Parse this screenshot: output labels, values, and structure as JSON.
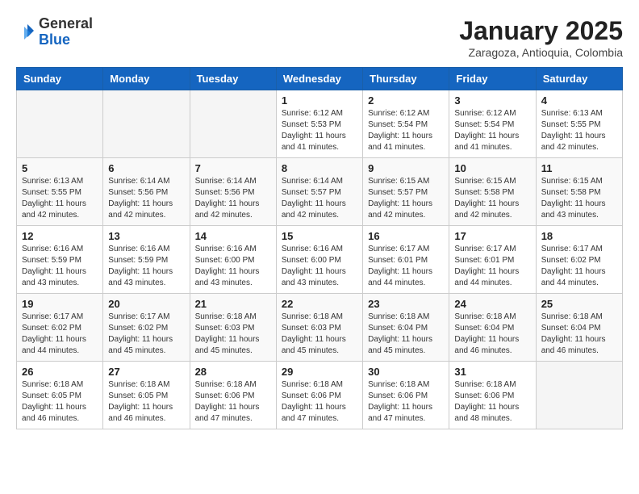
{
  "header": {
    "logo_general": "General",
    "logo_blue": "Blue",
    "month_title": "January 2025",
    "location": "Zaragoza, Antioquia, Colombia"
  },
  "weekdays": [
    "Sunday",
    "Monday",
    "Tuesday",
    "Wednesday",
    "Thursday",
    "Friday",
    "Saturday"
  ],
  "weeks": [
    [
      {
        "day": "",
        "info": ""
      },
      {
        "day": "",
        "info": ""
      },
      {
        "day": "",
        "info": ""
      },
      {
        "day": "1",
        "info": "Sunrise: 6:12 AM\nSunset: 5:53 PM\nDaylight: 11 hours and 41 minutes."
      },
      {
        "day": "2",
        "info": "Sunrise: 6:12 AM\nSunset: 5:54 PM\nDaylight: 11 hours and 41 minutes."
      },
      {
        "day": "3",
        "info": "Sunrise: 6:12 AM\nSunset: 5:54 PM\nDaylight: 11 hours and 41 minutes."
      },
      {
        "day": "4",
        "info": "Sunrise: 6:13 AM\nSunset: 5:55 PM\nDaylight: 11 hours and 42 minutes."
      }
    ],
    [
      {
        "day": "5",
        "info": "Sunrise: 6:13 AM\nSunset: 5:55 PM\nDaylight: 11 hours and 42 minutes."
      },
      {
        "day": "6",
        "info": "Sunrise: 6:14 AM\nSunset: 5:56 PM\nDaylight: 11 hours and 42 minutes."
      },
      {
        "day": "7",
        "info": "Sunrise: 6:14 AM\nSunset: 5:56 PM\nDaylight: 11 hours and 42 minutes."
      },
      {
        "day": "8",
        "info": "Sunrise: 6:14 AM\nSunset: 5:57 PM\nDaylight: 11 hours and 42 minutes."
      },
      {
        "day": "9",
        "info": "Sunrise: 6:15 AM\nSunset: 5:57 PM\nDaylight: 11 hours and 42 minutes."
      },
      {
        "day": "10",
        "info": "Sunrise: 6:15 AM\nSunset: 5:58 PM\nDaylight: 11 hours and 42 minutes."
      },
      {
        "day": "11",
        "info": "Sunrise: 6:15 AM\nSunset: 5:58 PM\nDaylight: 11 hours and 43 minutes."
      }
    ],
    [
      {
        "day": "12",
        "info": "Sunrise: 6:16 AM\nSunset: 5:59 PM\nDaylight: 11 hours and 43 minutes."
      },
      {
        "day": "13",
        "info": "Sunrise: 6:16 AM\nSunset: 5:59 PM\nDaylight: 11 hours and 43 minutes."
      },
      {
        "day": "14",
        "info": "Sunrise: 6:16 AM\nSunset: 6:00 PM\nDaylight: 11 hours and 43 minutes."
      },
      {
        "day": "15",
        "info": "Sunrise: 6:16 AM\nSunset: 6:00 PM\nDaylight: 11 hours and 43 minutes."
      },
      {
        "day": "16",
        "info": "Sunrise: 6:17 AM\nSunset: 6:01 PM\nDaylight: 11 hours and 44 minutes."
      },
      {
        "day": "17",
        "info": "Sunrise: 6:17 AM\nSunset: 6:01 PM\nDaylight: 11 hours and 44 minutes."
      },
      {
        "day": "18",
        "info": "Sunrise: 6:17 AM\nSunset: 6:02 PM\nDaylight: 11 hours and 44 minutes."
      }
    ],
    [
      {
        "day": "19",
        "info": "Sunrise: 6:17 AM\nSunset: 6:02 PM\nDaylight: 11 hours and 44 minutes."
      },
      {
        "day": "20",
        "info": "Sunrise: 6:17 AM\nSunset: 6:02 PM\nDaylight: 11 hours and 45 minutes."
      },
      {
        "day": "21",
        "info": "Sunrise: 6:18 AM\nSunset: 6:03 PM\nDaylight: 11 hours and 45 minutes."
      },
      {
        "day": "22",
        "info": "Sunrise: 6:18 AM\nSunset: 6:03 PM\nDaylight: 11 hours and 45 minutes."
      },
      {
        "day": "23",
        "info": "Sunrise: 6:18 AM\nSunset: 6:04 PM\nDaylight: 11 hours and 45 minutes."
      },
      {
        "day": "24",
        "info": "Sunrise: 6:18 AM\nSunset: 6:04 PM\nDaylight: 11 hours and 46 minutes."
      },
      {
        "day": "25",
        "info": "Sunrise: 6:18 AM\nSunset: 6:04 PM\nDaylight: 11 hours and 46 minutes."
      }
    ],
    [
      {
        "day": "26",
        "info": "Sunrise: 6:18 AM\nSunset: 6:05 PM\nDaylight: 11 hours and 46 minutes."
      },
      {
        "day": "27",
        "info": "Sunrise: 6:18 AM\nSunset: 6:05 PM\nDaylight: 11 hours and 46 minutes."
      },
      {
        "day": "28",
        "info": "Sunrise: 6:18 AM\nSunset: 6:06 PM\nDaylight: 11 hours and 47 minutes."
      },
      {
        "day": "29",
        "info": "Sunrise: 6:18 AM\nSunset: 6:06 PM\nDaylight: 11 hours and 47 minutes."
      },
      {
        "day": "30",
        "info": "Sunrise: 6:18 AM\nSunset: 6:06 PM\nDaylight: 11 hours and 47 minutes."
      },
      {
        "day": "31",
        "info": "Sunrise: 6:18 AM\nSunset: 6:06 PM\nDaylight: 11 hours and 48 minutes."
      },
      {
        "day": "",
        "info": ""
      }
    ]
  ]
}
